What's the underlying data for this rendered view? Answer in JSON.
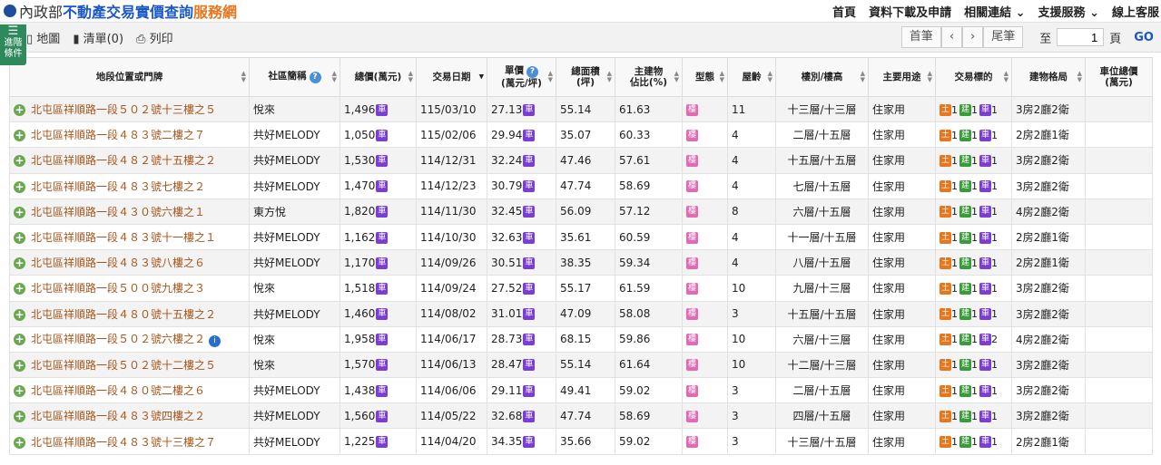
{
  "header": {
    "ministry": "內政部",
    "title_main": "不動產交易實價查詢",
    "title_accent": "服務網",
    "nav": [
      "首頁",
      "資料下載及申請",
      "相關連結",
      "支援服務",
      "線上客服"
    ]
  },
  "toolbar": {
    "advanced_label_1": "進階",
    "advanced_label_2": "條件",
    "map_label": "地圖",
    "list_label": "清單(0)",
    "print_label": "列印"
  },
  "pager": {
    "first": "首筆",
    "prev": "‹",
    "next": "›",
    "last": "尾筆",
    "to_label": "至",
    "page_value": "1",
    "page_label": "頁",
    "go": "GO"
  },
  "table": {
    "headers": {
      "addr": "地段位置或門牌",
      "community": "社區簡稱",
      "total": "總價(萬元)",
      "date": "交易日期",
      "unit1": "單價",
      "unit2": "(萬元/坪)",
      "area1": "總面積",
      "area2": "(坪)",
      "ratio1": "主建物",
      "ratio2": "佔比(%)",
      "type": "型態",
      "age": "屋齡",
      "floor": "樓別/樓高",
      "use": "主要用途",
      "target": "交易標的",
      "layout": "建物格局",
      "park1": "車位總價",
      "park2": "(萬元)"
    },
    "tags": {
      "car": "車",
      "bld": "樓",
      "land": "土",
      "bldg": "建",
      "park": "車"
    },
    "rows": [
      {
        "addr": "北屯區祥順路一段５０２號十三樓之５",
        "community": "悅來",
        "total": "1,496",
        "date": "115/03/10",
        "unit": "27.13",
        "area": "55.14",
        "ratio": "61.63",
        "age": "11",
        "floor": "十三層/十三層",
        "use": "住家用",
        "land": "1",
        "bldg": "1",
        "park": "1",
        "layout": "3房2廳2衛",
        "info": false
      },
      {
        "addr": "北屯區祥順路一段４８３號二樓之７",
        "community": "共好MELODY",
        "total": "1,050",
        "date": "115/02/06",
        "unit": "29.94",
        "area": "35.07",
        "ratio": "60.33",
        "age": "4",
        "floor": "二層/十五層",
        "use": "住家用",
        "land": "1",
        "bldg": "1",
        "park": "1",
        "layout": "2房2廳1衛",
        "info": false
      },
      {
        "addr": "北屯區祥順路一段４８２號十五樓之２",
        "community": "共好MELODY",
        "total": "1,530",
        "date": "114/12/31",
        "unit": "32.24",
        "area": "47.46",
        "ratio": "57.61",
        "age": "4",
        "floor": "十五層/十五層",
        "use": "住家用",
        "land": "1",
        "bldg": "1",
        "park": "1",
        "layout": "3房2廳2衛",
        "info": false
      },
      {
        "addr": "北屯區祥順路一段４８３號七樓之２",
        "community": "共好MELODY",
        "total": "1,470",
        "date": "114/12/23",
        "unit": "30.79",
        "area": "47.74",
        "ratio": "58.69",
        "age": "4",
        "floor": "七層/十五層",
        "use": "住家用",
        "land": "1",
        "bldg": "1",
        "park": "1",
        "layout": "3房2廳2衛",
        "info": false
      },
      {
        "addr": "北屯區祥順路一段４３０號六樓之１",
        "community": "東方悅",
        "total": "1,820",
        "date": "114/11/30",
        "unit": "32.45",
        "area": "56.09",
        "ratio": "57.12",
        "age": "8",
        "floor": "六層/十五層",
        "use": "住家用",
        "land": "1",
        "bldg": "1",
        "park": "1",
        "layout": "4房2廳2衛",
        "info": false
      },
      {
        "addr": "北屯區祥順路一段４８３號十一樓之１",
        "community": "共好MELODY",
        "total": "1,162",
        "date": "114/10/30",
        "unit": "32.63",
        "area": "35.61",
        "ratio": "60.59",
        "age": "4",
        "floor": "十一層/十五層",
        "use": "住家用",
        "land": "1",
        "bldg": "1",
        "park": "1",
        "layout": "2房2廳1衛",
        "info": false
      },
      {
        "addr": "北屯區祥順路一段４８３號八樓之６",
        "community": "共好MELODY",
        "total": "1,170",
        "date": "114/09/26",
        "unit": "30.51",
        "area": "38.35",
        "ratio": "59.34",
        "age": "4",
        "floor": "八層/十五層",
        "use": "住家用",
        "land": "1",
        "bldg": "1",
        "park": "1",
        "layout": "2房2廳1衛",
        "info": false
      },
      {
        "addr": "北屯區祥順路一段５００號九樓之３",
        "community": "悅來",
        "total": "1,518",
        "date": "114/09/24",
        "unit": "27.52",
        "area": "55.17",
        "ratio": "61.59",
        "age": "10",
        "floor": "九層/十三層",
        "use": "住家用",
        "land": "1",
        "bldg": "1",
        "park": "1",
        "layout": "3房2廳2衛",
        "info": false
      },
      {
        "addr": "北屯區祥順路一段４８０號十五樓之２",
        "community": "共好MELODY",
        "total": "1,460",
        "date": "114/08/02",
        "unit": "31.01",
        "area": "47.09",
        "ratio": "58.08",
        "age": "3",
        "floor": "十五層/十五層",
        "use": "住家用",
        "land": "1",
        "bldg": "1",
        "park": "1",
        "layout": "3房2廳2衛",
        "info": false
      },
      {
        "addr": "北屯區祥順路一段５０２號六樓之２",
        "community": "悅來",
        "total": "1,958",
        "date": "114/06/17",
        "unit": "28.73",
        "area": "68.15",
        "ratio": "59.86",
        "age": "10",
        "floor": "六層/十三層",
        "use": "住家用",
        "land": "1",
        "bldg": "1",
        "park": "2",
        "layout": "4房2廳2衛",
        "info": true
      },
      {
        "addr": "北屯區祥順路一段５０２號十二樓之５",
        "community": "悅來",
        "total": "1,570",
        "date": "114/06/13",
        "unit": "28.47",
        "area": "55.14",
        "ratio": "61.64",
        "age": "10",
        "floor": "十二層/十三層",
        "use": "住家用",
        "land": "1",
        "bldg": "1",
        "park": "1",
        "layout": "3房2廳2衛",
        "info": false
      },
      {
        "addr": "北屯區祥順路一段４８０號二樓之６",
        "community": "共好MELODY",
        "total": "1,438",
        "date": "114/06/06",
        "unit": "29.11",
        "area": "49.41",
        "ratio": "59.02",
        "age": "3",
        "floor": "二層/十五層",
        "use": "住家用",
        "land": "1",
        "bldg": "1",
        "park": "1",
        "layout": "3房2廳2衛",
        "info": false
      },
      {
        "addr": "北屯區祥順路一段４８３號四樓之２",
        "community": "共好MELODY",
        "total": "1,560",
        "date": "114/05/22",
        "unit": "32.68",
        "area": "47.74",
        "ratio": "58.69",
        "age": "3",
        "floor": "四層/十五層",
        "use": "住家用",
        "land": "1",
        "bldg": "1",
        "park": "1",
        "layout": "3房2廳2衛",
        "info": false
      },
      {
        "addr": "北屯區祥順路一段４８３號十三樓之７",
        "community": "共好MELODY",
        "total": "1,225",
        "date": "114/04/20",
        "unit": "34.35",
        "area": "35.66",
        "ratio": "59.02",
        "age": "3",
        "floor": "十三層/十五層",
        "use": "住家用",
        "land": "1",
        "bldg": "1",
        "park": "1",
        "layout": "2房2廳1衛",
        "info": false
      }
    ]
  }
}
